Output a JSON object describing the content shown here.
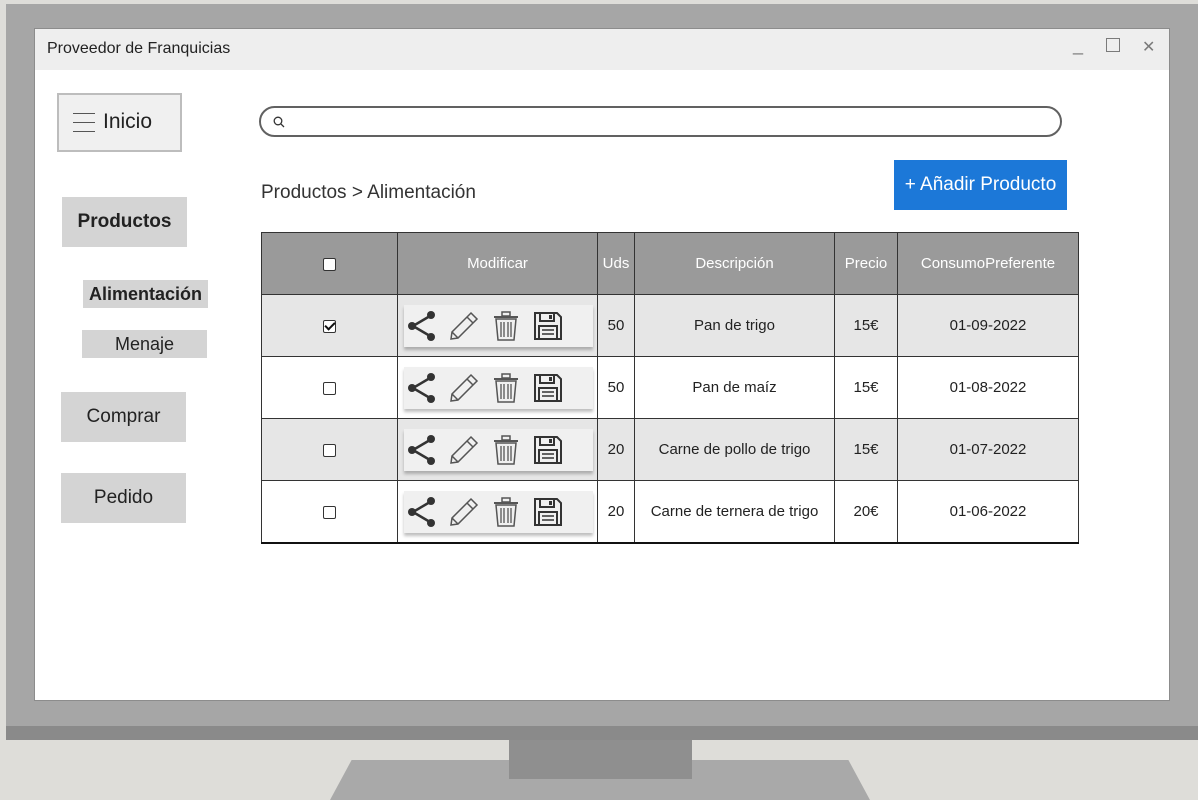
{
  "window": {
    "title": "Proveedor de Franquicias",
    "minimize": "_",
    "maximize": "☐",
    "close": "✕"
  },
  "sidebar": {
    "menu_label": "Inicio",
    "productos": "Productos",
    "alimentacion": "Alimentación",
    "menaje": "Menaje",
    "comprar": "Comprar",
    "pedido": "Pedido"
  },
  "search": {
    "placeholder": ""
  },
  "breadcrumb": "Productos > Alimentación",
  "add_button": "+ Añadir Producto",
  "table": {
    "headers": {
      "modificar": "Modificar",
      "uds": "Uds",
      "descripcion": "Descripción",
      "precio": "Precio",
      "consumo": "ConsumoPreferente"
    },
    "rows": [
      {
        "checked": true,
        "uds": "50",
        "descripcion": "Pan de trigo",
        "precio": "15€",
        "consumo": "01-09-2022"
      },
      {
        "checked": false,
        "uds": "50",
        "descripcion": "Pan de maíz",
        "precio": "15€",
        "consumo": "01-08-2022"
      },
      {
        "checked": false,
        "uds": "20",
        "descripcion": "Carne de pollo de trigo",
        "precio": "15€",
        "consumo": "01-07-2022"
      },
      {
        "checked": false,
        "uds": "20",
        "descripcion": "Carne de ternera de trigo",
        "precio": "20€",
        "consumo": "01-06-2022"
      }
    ],
    "row_icons": [
      "share-icon",
      "pencil-icon",
      "trash-icon",
      "save-icon"
    ]
  },
  "colors": {
    "accent": "#1c78d8",
    "header_bg": "#9a9a9a",
    "row_shaded": "#e6e6e6",
    "side_button": "#d4d4d4"
  }
}
